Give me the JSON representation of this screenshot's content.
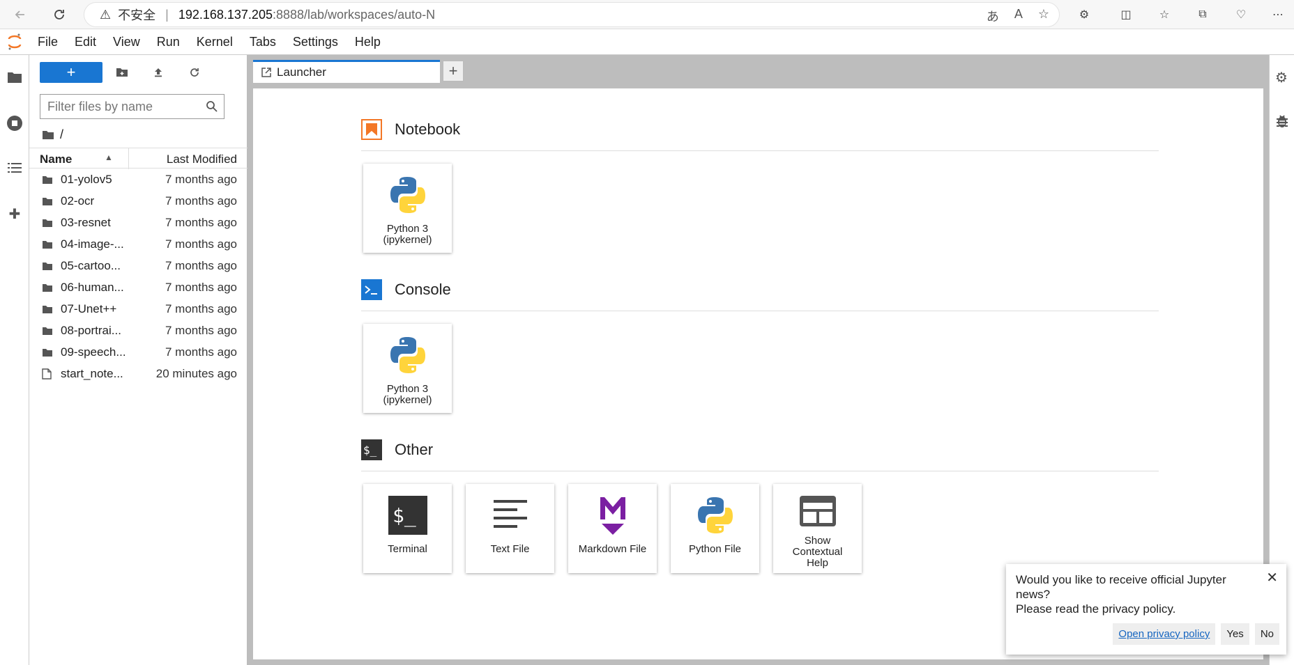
{
  "browser": {
    "insecure_label": "不安全",
    "separator": "|",
    "url_host": "192.168.137.205",
    "url_path": ":8888/lab/workspaces/auto-N"
  },
  "menubar": {
    "items": [
      "File",
      "Edit",
      "View",
      "Run",
      "Kernel",
      "Tabs",
      "Settings",
      "Help"
    ]
  },
  "filebrowser": {
    "new_label": "+",
    "filter_placeholder": "Filter files by name",
    "breadcrumb": "/",
    "col_name": "Name",
    "col_modified": "Last Modified",
    "items": [
      {
        "name": "01-yolov5",
        "modified": "7 months ago",
        "type": "folder"
      },
      {
        "name": "02-ocr",
        "modified": "7 months ago",
        "type": "folder"
      },
      {
        "name": "03-resnet",
        "modified": "7 months ago",
        "type": "folder"
      },
      {
        "name": "04-image-...",
        "modified": "7 months ago",
        "type": "folder"
      },
      {
        "name": "05-cartoo...",
        "modified": "7 months ago",
        "type": "folder"
      },
      {
        "name": "06-human...",
        "modified": "7 months ago",
        "type": "folder"
      },
      {
        "name": "07-Unet++",
        "modified": "7 months ago",
        "type": "folder"
      },
      {
        "name": "08-portrai...",
        "modified": "7 months ago",
        "type": "folder"
      },
      {
        "name": "09-speech...",
        "modified": "7 months ago",
        "type": "folder"
      },
      {
        "name": "start_note...",
        "modified": "20 minutes ago",
        "type": "file"
      }
    ]
  },
  "tabs": {
    "launcher_label": "Launcher",
    "add_label": "+"
  },
  "launcher": {
    "notebook_title": "Notebook",
    "console_title": "Console",
    "other_title": "Other",
    "notebook_cards": [
      {
        "line1": "Python 3",
        "line2": "(ipykernel)"
      }
    ],
    "console_cards": [
      {
        "line1": "Python 3",
        "line2": "(ipykernel)"
      }
    ],
    "other_cards": [
      {
        "label": "Terminal",
        "icon": "terminal-icon"
      },
      {
        "label": "Text File",
        "icon": "text-file-icon"
      },
      {
        "label": "Markdown File",
        "icon": "markdown-icon"
      },
      {
        "label": "Python File",
        "icon": "python-icon"
      },
      {
        "label": "Show Contextual Help",
        "icon": "contextual-help-icon"
      }
    ]
  },
  "notification": {
    "message_line1": "Would you like to receive official Jupyter news?",
    "message_line2": "Please read the privacy policy.",
    "privacy_link": "Open privacy policy",
    "yes": "Yes",
    "no": "No",
    "close": "✕"
  },
  "colors": {
    "accent": "#1976d2",
    "notebook_orange": "#f37726",
    "markdown_purple": "#7b1fa2",
    "python_blue": "#3a75b0",
    "python_yellow": "#ffd43b"
  }
}
